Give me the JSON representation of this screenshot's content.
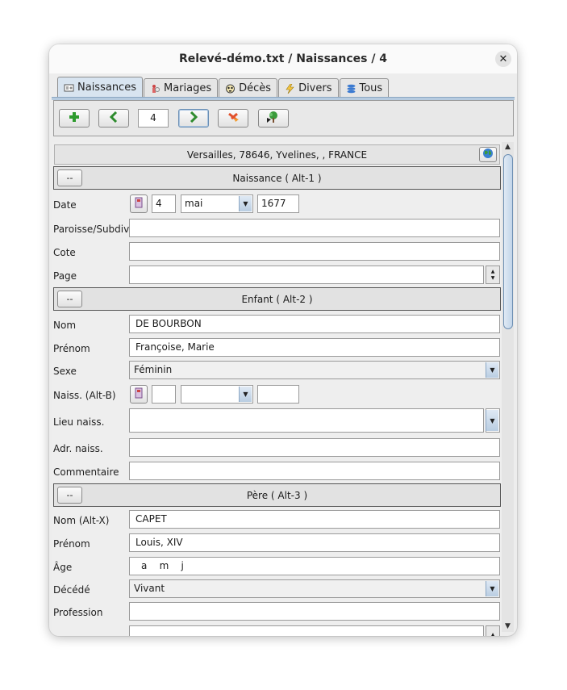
{
  "window": {
    "title": "Relevé-démo.txt / Naissances / 4"
  },
  "tabs": [
    {
      "label": "Naissances",
      "icon": "birth-card-icon"
    },
    {
      "label": "Mariages",
      "icon": "wedding-icon"
    },
    {
      "label": "Décès",
      "icon": "skull-icon"
    },
    {
      "label": "Divers",
      "icon": "lightning-icon"
    },
    {
      "label": "Tous",
      "icon": "stack-icon"
    }
  ],
  "toolbar": {
    "record_number": "4"
  },
  "place": {
    "text": "Versailles, 78646, Yvelines, , FRANCE"
  },
  "sections": {
    "naissance": {
      "title": "Naissance   ( Alt-1 )",
      "button": "--"
    },
    "enfant": {
      "title": "Enfant   ( Alt-2 )",
      "button": "--"
    },
    "pere": {
      "title": "Père   ( Alt-3 )",
      "button": "--"
    }
  },
  "naissance": {
    "date_label": "Date",
    "day": "4",
    "month": "mai",
    "year": "1677",
    "paroisse_label": "Paroisse/Subdiv.",
    "paroisse": "",
    "cote_label": "Cote",
    "cote": "",
    "page_label": "Page",
    "page": ""
  },
  "enfant": {
    "nom_label": "Nom",
    "nom": "DE BOURBON",
    "prenom_label": "Prénom",
    "prenom": "Françoise, Marie",
    "sexe_label": "Sexe",
    "sexe": "Féminin",
    "naiss_label": "Naiss. (Alt-B)",
    "naiss_day": "",
    "naiss_month": "",
    "naiss_year": "",
    "lieu_label": "Lieu naiss.",
    "lieu": "",
    "adr_label": "Adr. naiss.",
    "adr": "",
    "commentaire_label": "Commentaire",
    "commentaire": ""
  },
  "pere": {
    "nom_label": "Nom (Alt-X)",
    "nom": "CAPET",
    "prenom_label": "Prénom",
    "prenom": "Louis, XIV",
    "age_label": "Âge",
    "age": "a    m    j",
    "decede_label": "Décédé",
    "decede": "Vivant",
    "profession_label": "Profession",
    "profession": ""
  },
  "colors": {
    "accent": "#b6cbe0",
    "add": "#2e9b2e",
    "nav": "#2e8b2e",
    "delete": "#e2502a"
  }
}
